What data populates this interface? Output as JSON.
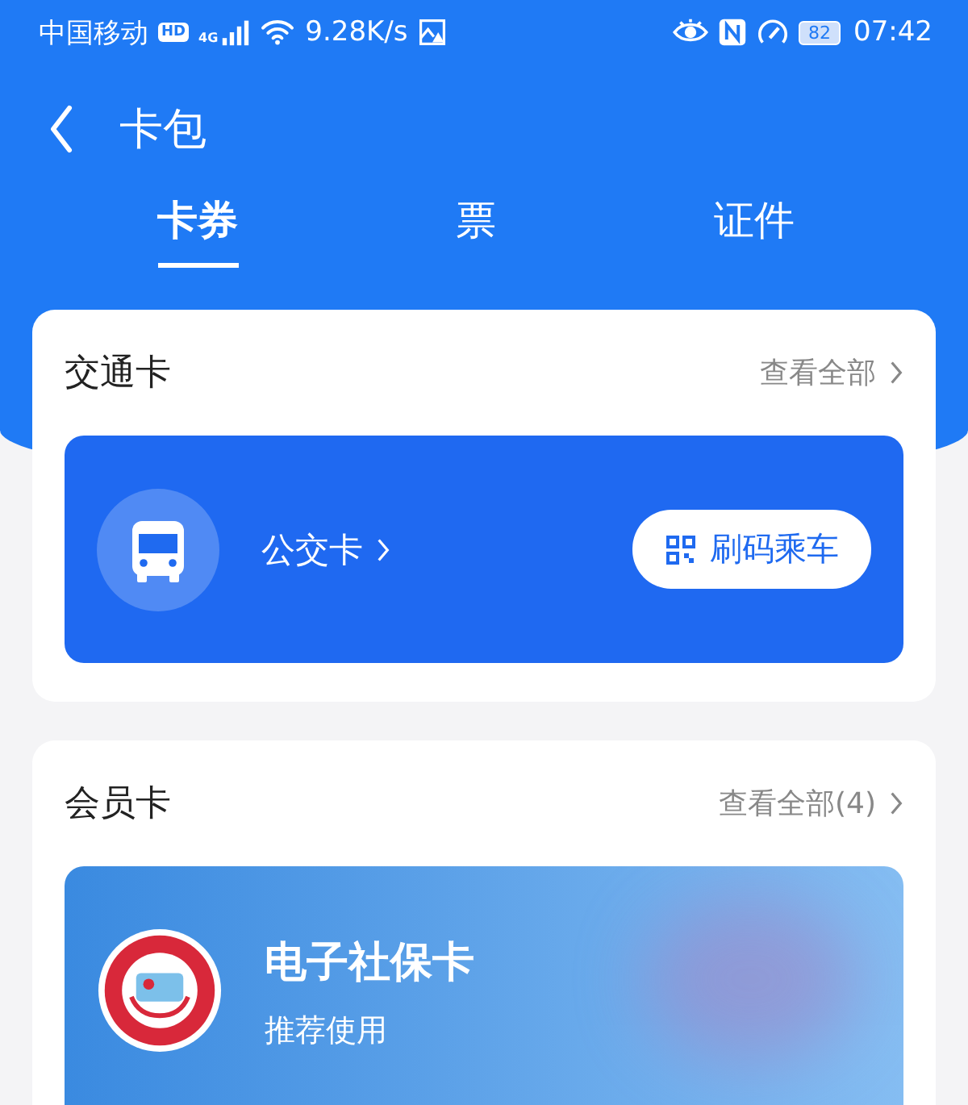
{
  "status_bar": {
    "carrier": "中国移动",
    "hd": "HD",
    "network": "4G",
    "speed": "9.28K/s",
    "battery": "82",
    "time": "07:42"
  },
  "header": {
    "title": "卡包"
  },
  "tabs": [
    {
      "label": "卡券",
      "selected": true
    },
    {
      "label": "票",
      "selected": false
    },
    {
      "label": "证件",
      "selected": false
    }
  ],
  "sections": [
    {
      "title": "交通卡",
      "more": "查看全部",
      "card": {
        "kind": "transit",
        "name": "公交卡",
        "button": "刷码乘车"
      }
    },
    {
      "title": "会员卡",
      "more": "查看全部(4)",
      "card": {
        "kind": "social",
        "name": "电子社保卡",
        "subtitle": "推荐使用"
      }
    }
  ]
}
